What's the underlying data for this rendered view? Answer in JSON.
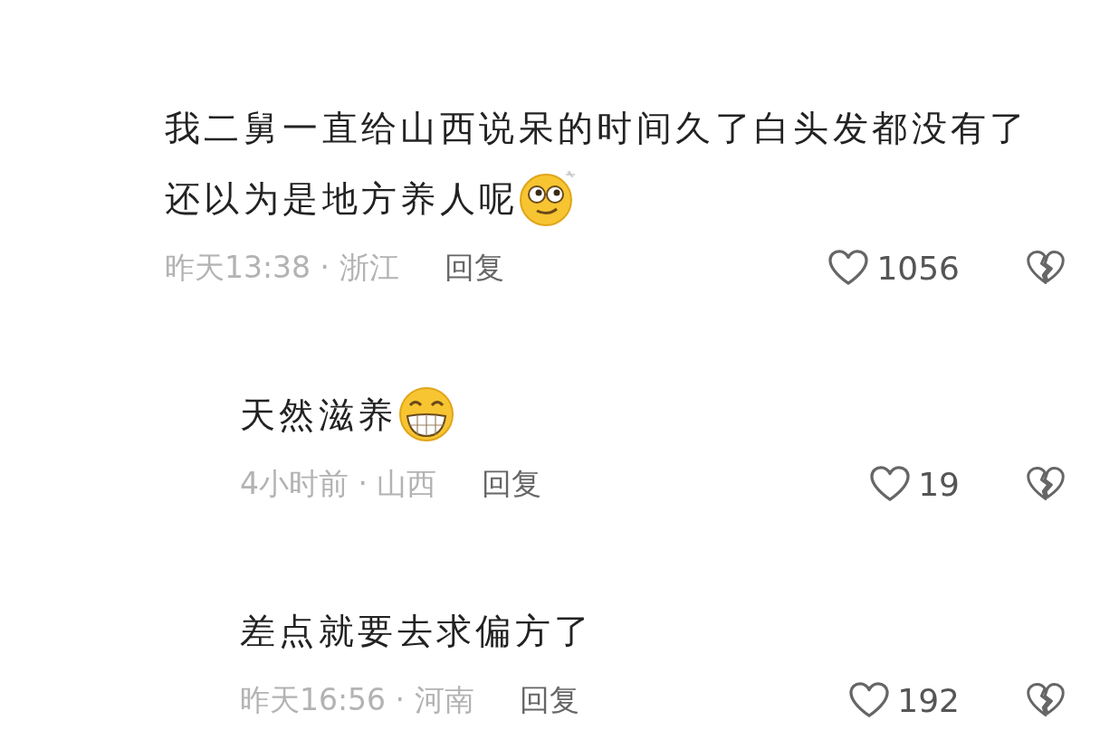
{
  "comments": [
    {
      "text": "我二舅一直给山西说呆的时间久了白头发都没有了还以为是地方养人呢",
      "emoji": {
        "kind": "dizzy"
      },
      "meta": "昨天13:38 · 浙江",
      "reply": "回复",
      "likes": "1056",
      "replies": [
        {
          "text": "天然滋养",
          "emoji": {
            "kind": "grin"
          },
          "meta": "4小时前 · 山西",
          "reply": "回复",
          "likes": "19"
        },
        {
          "text": "差点就要去求偏方了",
          "meta": "昨天16:56 · 河南",
          "reply": "回复",
          "likes": "192"
        }
      ]
    }
  ]
}
